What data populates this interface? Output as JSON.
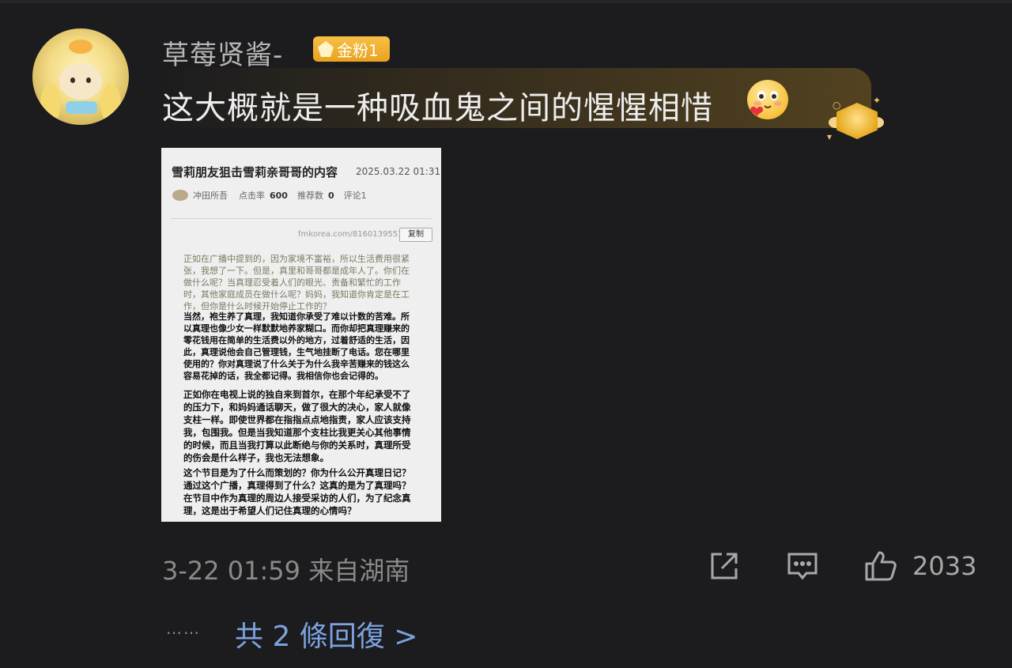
{
  "comment": {
    "username": "草莓贤酱-",
    "badge": "金粉1",
    "text": "这大概就是一种吸血鬼之间的惺惺相惜",
    "emoji": "smiling-face-with-heart-emoji",
    "decoration": "gold-medal-icon",
    "timestamp": "3-22 01:59 来自湖南",
    "like_count": "2033",
    "replies_link": "共 2 條回復 >",
    "replies_dots": "……"
  },
  "screenshot": {
    "title": "雪莉朋友狙击雪莉亲哥哥的内容",
    "date": "2025.03.22 01:31",
    "author": "冲田所吾",
    "clicks_label": "点击率",
    "clicks_value": "600",
    "recommend_label": "推荐数",
    "recommend_value": "0",
    "comments": "评论1",
    "url": "fmkorea.com/8160139551",
    "copy_button": "复制",
    "paragraph1": "正如在广播中提到的，因为家境不富裕，所以生活费用很紧张，我想了一下。但是，真里和哥哥都是成年人了。你们在做什么呢？当真理忍受着人们的眼光、责备和繁忙的工作时，其他家庭成员在做什么呢？妈妈，我知道你肯定是在工作，但你是什么时候开始停止工作的？",
    "paragraph2": "当然，袍生养了真理，我知道你承受了难以计数的苦难。所以真理也像少女一样默默地养家糊口。而你却把真理赚来的零花钱用在简单的生活费以外的地方，过着舒适的生活，因此，真理说他会自己管理钱，生气地挂断了电话。您在哪里使用的？你对真理说了什么关于为什么我辛苦赚来的钱这么容易花掉的话，我全都记得。我相信你也会记得的。",
    "paragraph3": "正如你在电视上说的独自来到首尔，在那个年纪承受不了的压力下，和妈妈通话聊天，做了很大的决心，家人就像支柱一样。即使世界都在指指点点地指责，家人应该支持我，包围我。但是当我知道那个支柱比我更关心其他事情的时候，而且当我打算以此断绝与你的关系时，真理所受的伤会是什么样子，我也无法想象。",
    "paragraph4": "这个节目是为了什么而策划的？你为什么公开真理日记？通过这个广播，真理得到了什么？这真的是为了真理吗？在节目中作为真理的周边人接受采访的人们，为了纪念真理，这是出于希望人们记住真理的心情吗？"
  },
  "icons": {
    "share": "share-icon",
    "comment": "comment-icon",
    "like": "thumbs-up-icon"
  }
}
